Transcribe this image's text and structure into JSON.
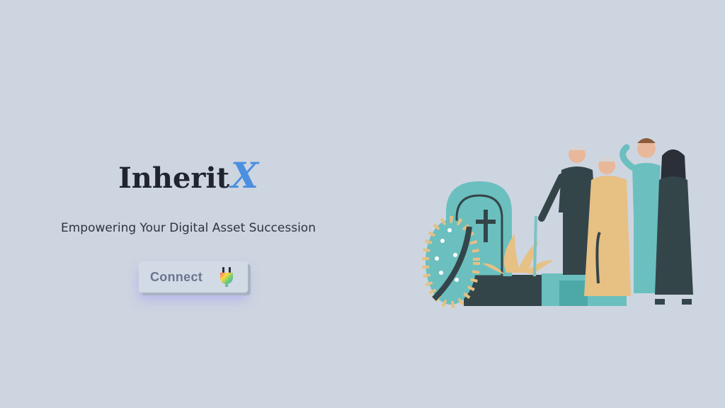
{
  "brand": {
    "name_main": "Inherit",
    "name_accent": "X",
    "accent_color": "#4a8fe0"
  },
  "hero": {
    "tagline": "Empowering Your Digital Asset Succession",
    "connect_button": {
      "label": "Connect",
      "icon": "plug-icon"
    }
  },
  "illustration": {
    "subject": "family mourning at a gravestone with a wreath"
  },
  "colors": {
    "background": "#cdd5e0",
    "teal": "#6bbfbf",
    "dark": "#34454a"
  }
}
